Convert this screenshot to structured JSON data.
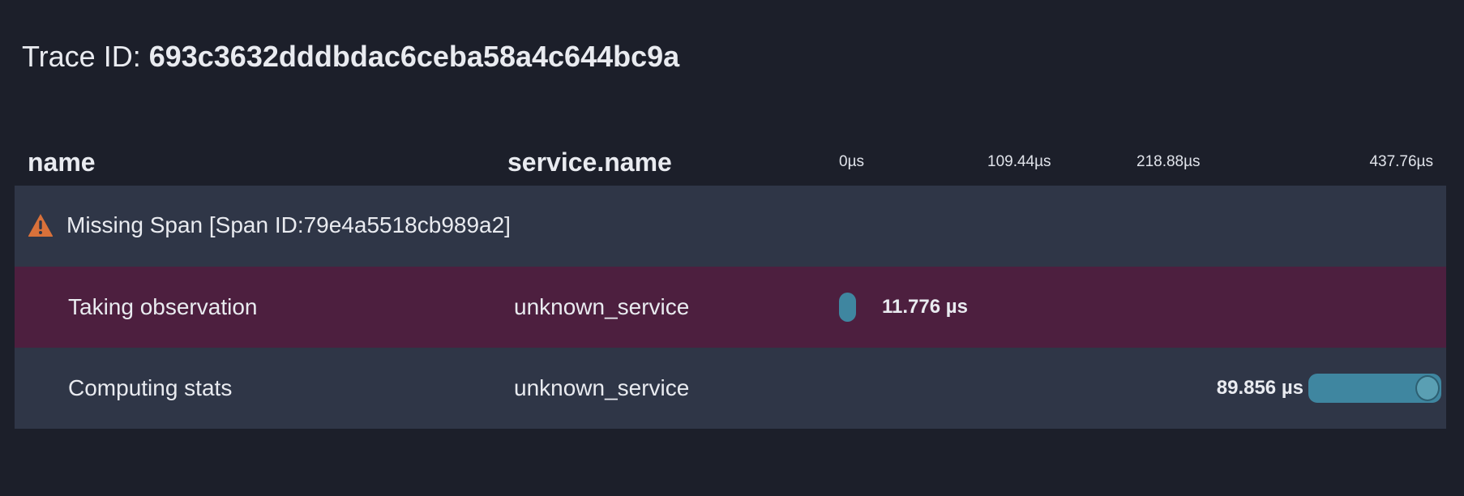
{
  "trace": {
    "label": "Trace ID: ",
    "id": "693c3632dddbdac6ceba58a4c644bc9a"
  },
  "columns": {
    "name": "name",
    "service": "service.name"
  },
  "timeline": {
    "ticks": [
      "0µs",
      "109.44µs",
      "218.88µs",
      "437.76µs"
    ]
  },
  "rows": [
    {
      "type": "missing",
      "text": "Missing Span [Span ID:79e4a5518cb989a2]",
      "icon": "warning-icon"
    },
    {
      "type": "span",
      "status": "error",
      "name": "Taking observation",
      "service": "unknown_service",
      "duration": "11.776 µs"
    },
    {
      "type": "span",
      "status": "ok",
      "name": "Computing stats",
      "service": "unknown_service",
      "duration": "89.856 µs"
    }
  ],
  "colors": {
    "background": "#1c1f2a",
    "row": "#2f3647",
    "error_row": "#4d1f3f",
    "bar": "#3f86a0",
    "warning": "#d9713a"
  }
}
